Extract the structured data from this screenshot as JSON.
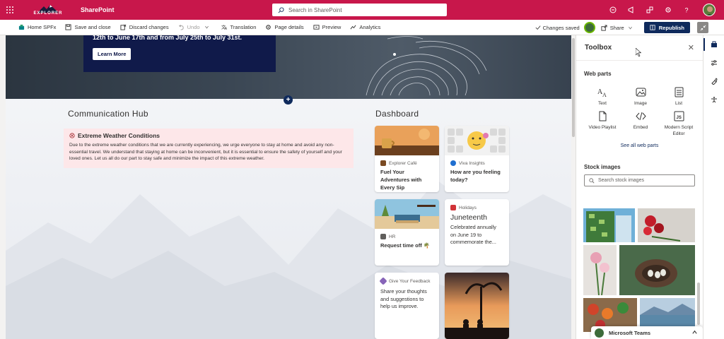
{
  "suite": {
    "logo_text": "EXPLORER",
    "app_name": "SharePoint",
    "search_placeholder": "Search in SharePoint",
    "brand_color": "#c8174b"
  },
  "commandbar": {
    "items": [
      {
        "label": "Home SPFx",
        "icon": "home-icon"
      },
      {
        "label": "Save and close",
        "icon": "save-icon"
      },
      {
        "label": "Discard changes",
        "icon": "discard-icon"
      },
      {
        "label": "Undo",
        "icon": "undo-icon",
        "disabled": true
      },
      {
        "label": "Translation",
        "icon": "translation-icon"
      },
      {
        "label": "Page details",
        "icon": "gear-icon"
      },
      {
        "label": "Preview",
        "icon": "preview-icon"
      },
      {
        "label": "Analytics",
        "icon": "analytics-icon"
      }
    ],
    "status": "Changes saved",
    "share_label": "Share",
    "republish_label": "Republish"
  },
  "hero": {
    "text": "12th to June 17th and from July 25th to July 31st.",
    "button": "Learn More"
  },
  "communication_hub": {
    "title": "Communication Hub",
    "alert_title": "Extreme Weather Conditions",
    "alert_body": "Due to the extreme weather conditions that we are currently experiencing, we urge everyone to stay at home and avoid any non-essential travel. We understand that staying at home can be inconvenient, but it is essential to ensure the safety of yourself and your loved ones. Let us all do our part to stay safe and minimize the impact of this extreme weather."
  },
  "dashboard": {
    "title": "Dashboard",
    "cards": [
      {
        "meta": "Explorer Café",
        "title": "Fuel Your Adventures with Every Sip"
      },
      {
        "meta": "Viva Insights",
        "title": "How are you feeling today?"
      },
      {
        "meta": "HR",
        "title": "Request time off 🌴"
      },
      {
        "meta": "Holidays",
        "big": "Juneteenth",
        "body": "Celebrated annually on June 19 to commemorate the..."
      },
      {
        "meta": "Give Your Feedback",
        "body": "Share your thoughts and suggestions to help us improve."
      }
    ]
  },
  "toolbox": {
    "title": "Toolbox",
    "web_parts_title": "Web parts",
    "web_parts": [
      {
        "label": "Text",
        "icon": "text-icon"
      },
      {
        "label": "Image",
        "icon": "image-icon"
      },
      {
        "label": "List",
        "icon": "list-icon"
      },
      {
        "label": "Video Playlist",
        "icon": "document-icon"
      },
      {
        "label": "Embed",
        "icon": "embed-icon"
      },
      {
        "label": "Modern Script Editor",
        "icon": "script-editor-icon"
      }
    ],
    "see_all": "See all web parts",
    "stock_title": "Stock images",
    "stock_search_placeholder": "Search stock images"
  },
  "teams": {
    "label": "Microsoft Teams"
  }
}
